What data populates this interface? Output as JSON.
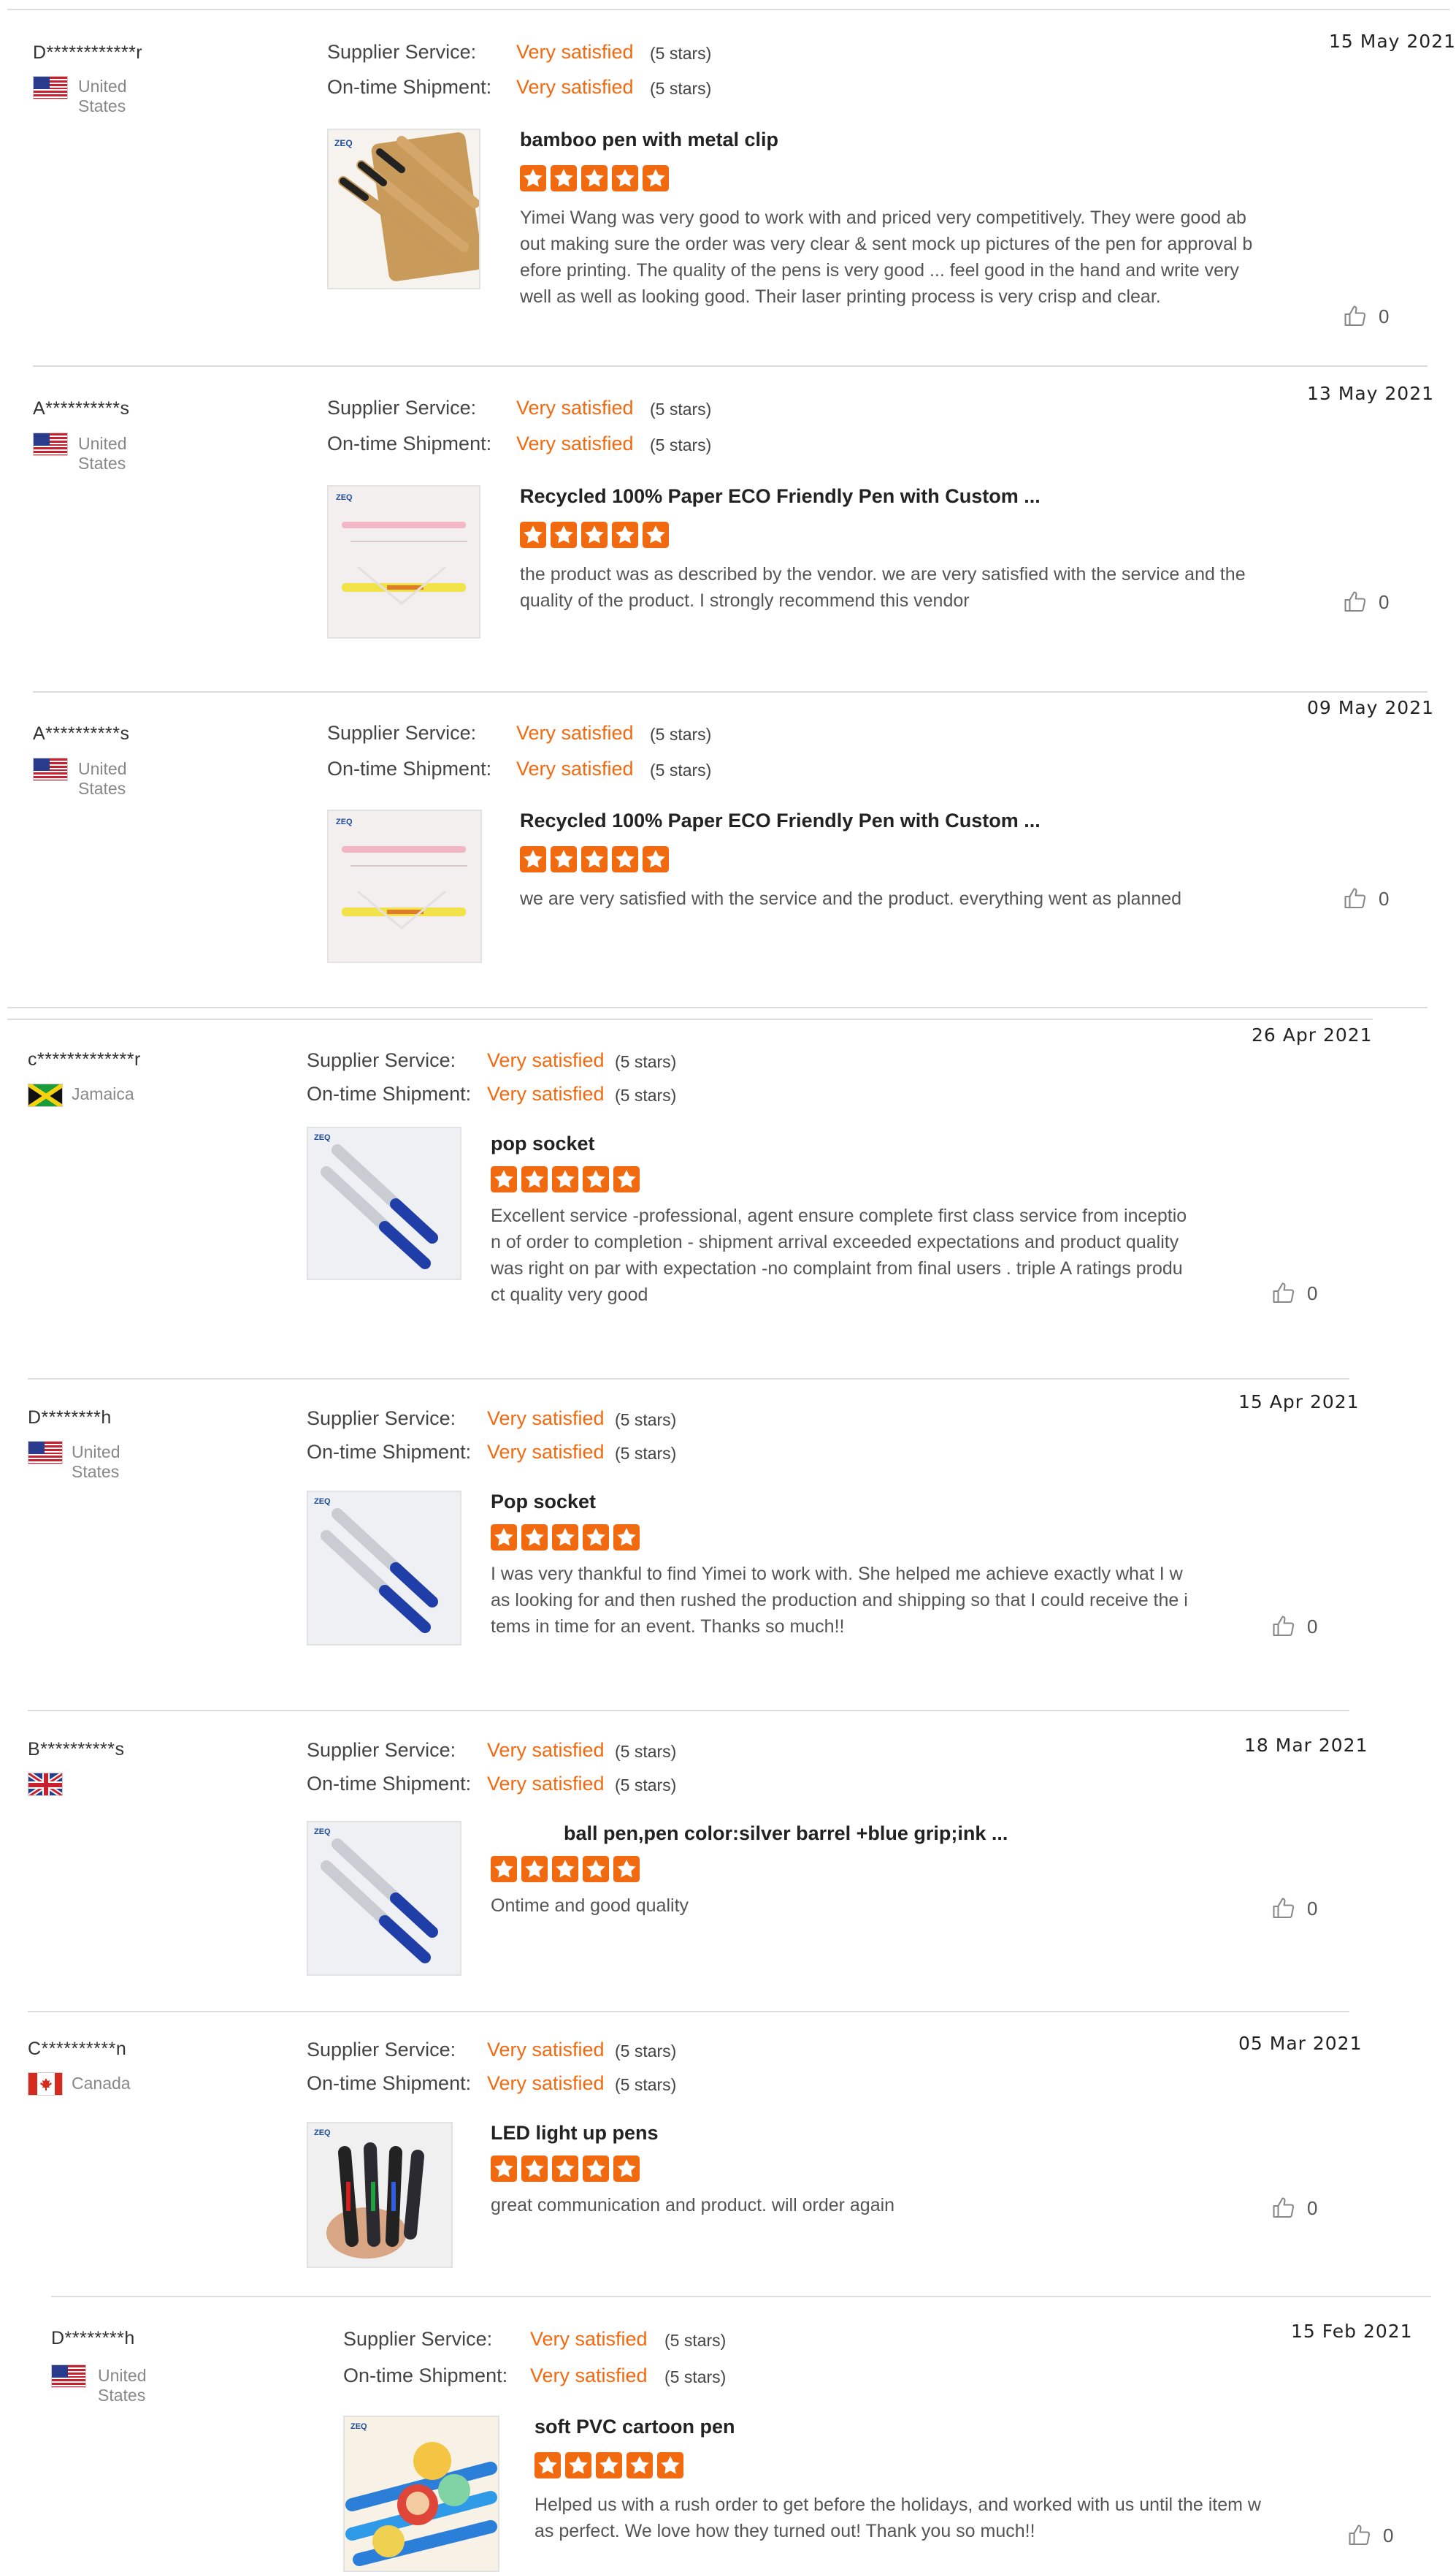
{
  "colors": {
    "accent": "#f26a10",
    "star": "#f26a10",
    "divider": "#dcdcdc"
  },
  "labels": {
    "supplier": "Supplier Service:",
    "shipment": "On-time Shipment:"
  },
  "reviews": [
    {
      "name": "D************r",
      "flag": "us",
      "country": "United States",
      "supplier_rating": "Very satisfied",
      "supplier_stars": "(5 stars)",
      "shipment_rating": "Very satisfied",
      "shipment_stars": "(5 stars)",
      "date": "15 May 2021",
      "product": "bamboo pen with metal clip",
      "rating": 5,
      "thumb": "bamboo",
      "comment": "Yimei Wang was very good to work with and priced very competitively.  They were good about making sure the order was very clear & sent mock up pictures of the pen for approval before printing.  The quality of the pens is very good ... feel good in the hand and write very well as well as looking good.  Their laser printing process is very crisp and clear.",
      "likes": "0"
    },
    {
      "name": "A**********s",
      "flag": "us",
      "country": "United States",
      "supplier_rating": "Very satisfied",
      "supplier_stars": "(5 stars)",
      "shipment_rating": "Very satisfied",
      "shipment_stars": "(5 stars)",
      "date": "13 May 2021",
      "product": "Recycled 100% Paper ECO Friendly Pen with Custom ...",
      "rating": 5,
      "thumb": "paper",
      "comment": "the product was as described by the vendor. we are very satisfied with the service and the quality of the product. I  strongly recommend this vendor",
      "likes": "0"
    },
    {
      "name": "A**********s",
      "flag": "us",
      "country": "United States",
      "supplier_rating": "Very satisfied",
      "supplier_stars": "(5 stars)",
      "shipment_rating": "Very satisfied",
      "shipment_stars": "(5 stars)",
      "date": "09 May 2021",
      "product": "Recycled 100% Paper ECO Friendly Pen with Custom ...",
      "rating": 5,
      "thumb": "paper",
      "comment": "we are very satisfied with the service and the product. everything went as planned",
      "likes": "0"
    },
    {
      "name": "c*************r",
      "flag": "jm",
      "country": "Jamaica",
      "supplier_rating": "Very satisfied",
      "supplier_stars": "(5 stars)",
      "shipment_rating": "Very satisfied",
      "shipment_stars": "(5 stars)",
      "date": "26 Apr 2021",
      "product": "pop socket",
      "rating": 5,
      "thumb": "bluepen",
      "comment": "Excellent service   -professional, agent ensure complete first class service from inception of order to completion - shipment arrival exceeded expectations and product quality was right on par with expectation -no complaint from final users . triple A ratings product quality very good",
      "likes": "0"
    },
    {
      "name": "D********h",
      "flag": "us",
      "country": "United States",
      "supplier_rating": "Very satisfied",
      "supplier_stars": "(5 stars)",
      "shipment_rating": "Very satisfied",
      "shipment_stars": "(5 stars)",
      "date": "15 Apr 2021",
      "product": "Pop socket",
      "rating": 5,
      "thumb": "bluepen",
      "comment": "I was very thankful to find Yimei to work with. She helped me achieve exactly what I was looking for and then rushed the production and shipping so that I could receive the items in time for an event. Thanks so much!!",
      "likes": "0"
    },
    {
      "name": "B**********s",
      "flag": "gb",
      "country": "",
      "supplier_rating": "Very satisfied",
      "supplier_stars": "(5 stars)",
      "shipment_rating": "Very satisfied",
      "shipment_stars": "(5 stars)",
      "date": "18 Mar 2021",
      "product": "ball pen,pen color:silver barrel +blue grip;ink ...",
      "rating": 5,
      "thumb": "bluepen",
      "comment": "Ontime and good quality",
      "likes": "0"
    },
    {
      "name": "C**********n",
      "flag": "ca",
      "country": "Canada",
      "supplier_rating": "Very satisfied",
      "supplier_stars": "(5 stars)",
      "shipment_rating": "Very satisfied",
      "shipment_stars": "(5 stars)",
      "date": "05 Mar 2021",
      "product": "LED light up pens",
      "rating": 5,
      "thumb": "led",
      "comment": "great communication and product. will order again",
      "likes": "0"
    },
    {
      "name": "D********h",
      "flag": "us",
      "country": "United States",
      "supplier_rating": "Very satisfied",
      "supplier_stars": "(5 stars)",
      "shipment_rating": "Very satisfied",
      "shipment_stars": "(5 stars)",
      "date": "15 Feb 2021",
      "product": "soft PVC cartoon pen",
      "rating": 5,
      "thumb": "cartoon",
      "comment": "Helped us with a rush order to get before the holidays, and worked with us until the item was perfect. We love how they turned out! Thank you so much!!",
      "likes": "0"
    }
  ]
}
